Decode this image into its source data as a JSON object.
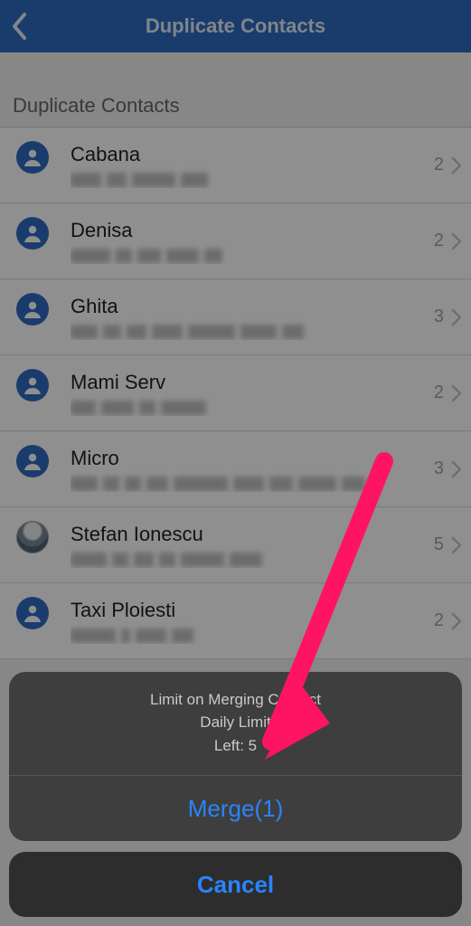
{
  "header": {
    "title": "Duplicate Contacts"
  },
  "section_heading": "Duplicate Contacts",
  "contacts": [
    {
      "name": "Cabana",
      "count": "2"
    },
    {
      "name": "Denisa",
      "count": "2"
    },
    {
      "name": "Ghita",
      "count": "3"
    },
    {
      "name": "Mami Serv",
      "count": "2"
    },
    {
      "name": "Micro",
      "count": "3"
    },
    {
      "name": "Stefan Ionescu",
      "count": "5"
    },
    {
      "name": "Taxi Ploiesti",
      "count": "2"
    }
  ],
  "sheet": {
    "line1": "Limit on Merging Contact",
    "line2": "Daily Limit",
    "line3": "Left: 5",
    "merge_label": "Merge(1)",
    "cancel_label": "Cancel"
  }
}
